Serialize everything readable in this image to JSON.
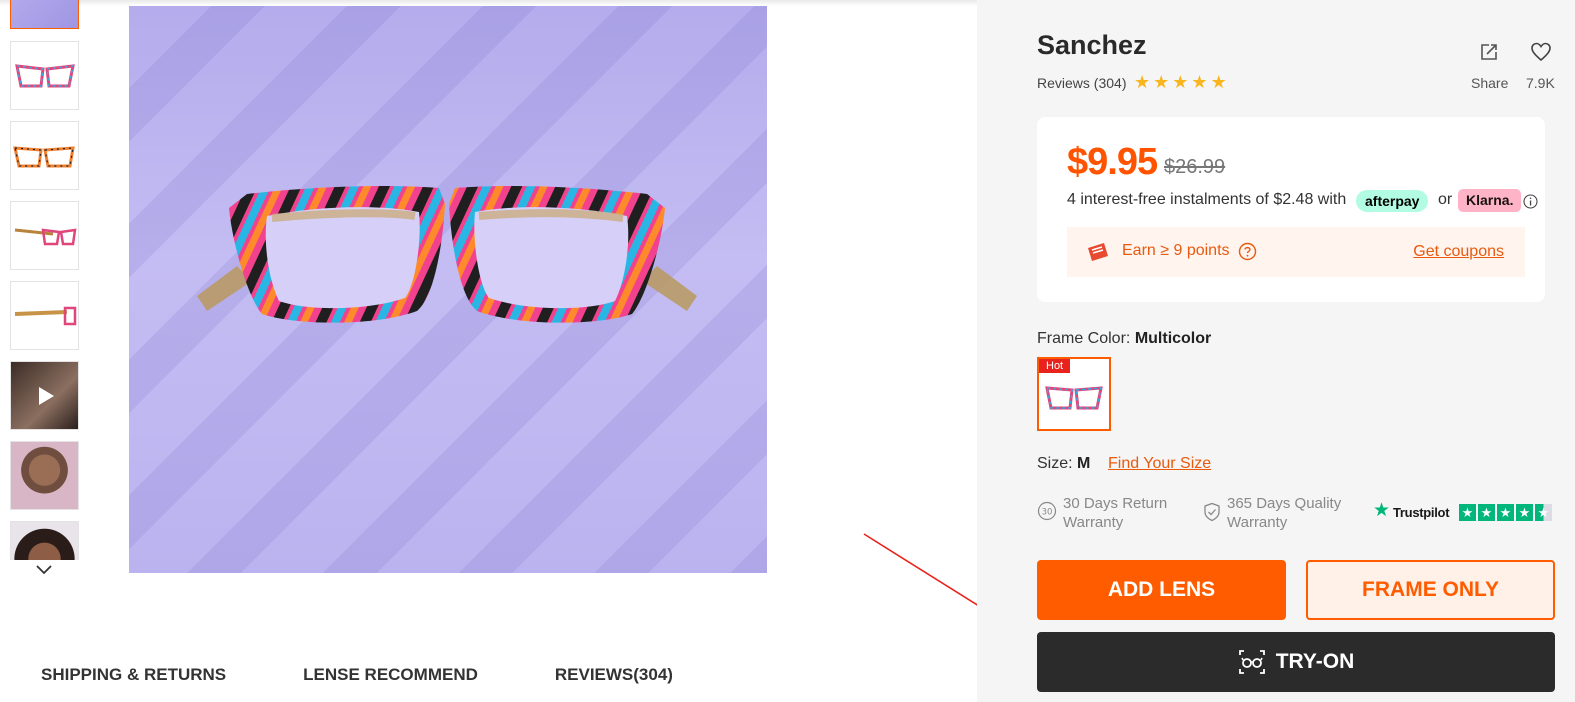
{
  "product": {
    "name": "Sanchez",
    "reviews_label": "Reviews (304)",
    "rating_stars": 5,
    "share_label": "Share",
    "favorites_count": "7.9K"
  },
  "pricing": {
    "price": "$9.95",
    "original_price": "$26.99",
    "instalment_text": "4 interest-free instalments of $2.48 with",
    "afterpay_label": "afterpay",
    "or_label": "or",
    "klarna_label": "Klarna.",
    "points_text": "Earn ≥ 9 points",
    "coupons_link": "Get coupons"
  },
  "frame_color": {
    "label": "Frame Color:",
    "value": "Multicolor",
    "swatch_badge": "Hot"
  },
  "size": {
    "label": "Size:",
    "value": "M",
    "find_link": "Find Your Size"
  },
  "guarantees": {
    "return_text": "30 Days Return Warranty",
    "quality_text": "365 Days Quality Warranty",
    "trustpilot_label": "Trustpilot",
    "trustpilot_rating": 4.5
  },
  "actions": {
    "add_lens": "ADD LENS",
    "frame_only": "FRAME ONLY",
    "try_on": "TRY-ON"
  },
  "tabs": [
    "SHIPPING & RETURNS",
    "LENSE RECOMMEND",
    "REVIEWS(304)"
  ],
  "colors": {
    "accent": "#ff5c00",
    "try_on_bg": "#2b2b2b",
    "star": "#f9b51e",
    "trustpilot": "#00b67a",
    "annotation_arrow": "#e8231d"
  }
}
